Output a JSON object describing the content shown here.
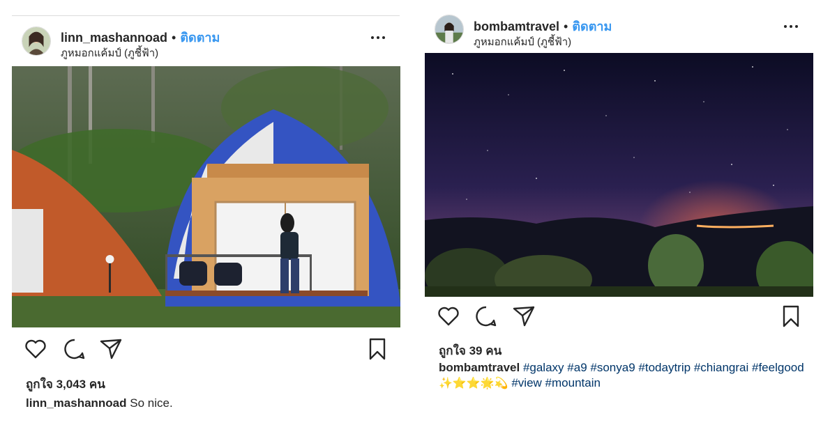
{
  "posts": [
    {
      "username": "linn_mashannoad",
      "separator": "•",
      "follow_label": "ติดตาม",
      "location": "ภูหมอกแค้มป์ (ภูชี้ฟ้า)",
      "photo_subject": "cabin-photo",
      "likes": "ถูกใจ 3,043 คน",
      "caption": {
        "username": "linn_mashannoad",
        "text": "So nice."
      }
    },
    {
      "username": "bombamtravel",
      "separator": "•",
      "follow_label": "ติดตาม",
      "location": "ภูหมอกแค้มป์ (ภูชี้ฟ้า)",
      "photo_subject": "night-sky-photo",
      "likes": "ถูกใจ 39 คน",
      "caption": {
        "username": "bombamtravel",
        "hashtags_line1": [
          "#galaxy",
          "#a9",
          "#sonya9",
          "#todaytrip",
          "#chiangrai"
        ],
        "hashtags_line2a": [
          "#feelgood"
        ],
        "emojis": "✨⭐⭐🌟💫",
        "hashtags_line2b": [
          "#view",
          "#mountain"
        ]
      }
    }
  ],
  "icons": [
    "heart-icon",
    "comment-icon",
    "share-icon",
    "bookmark-icon",
    "more-icon"
  ],
  "colors": {
    "follow": "#3897f0",
    "hashtag": "#003569",
    "text": "#262626"
  }
}
